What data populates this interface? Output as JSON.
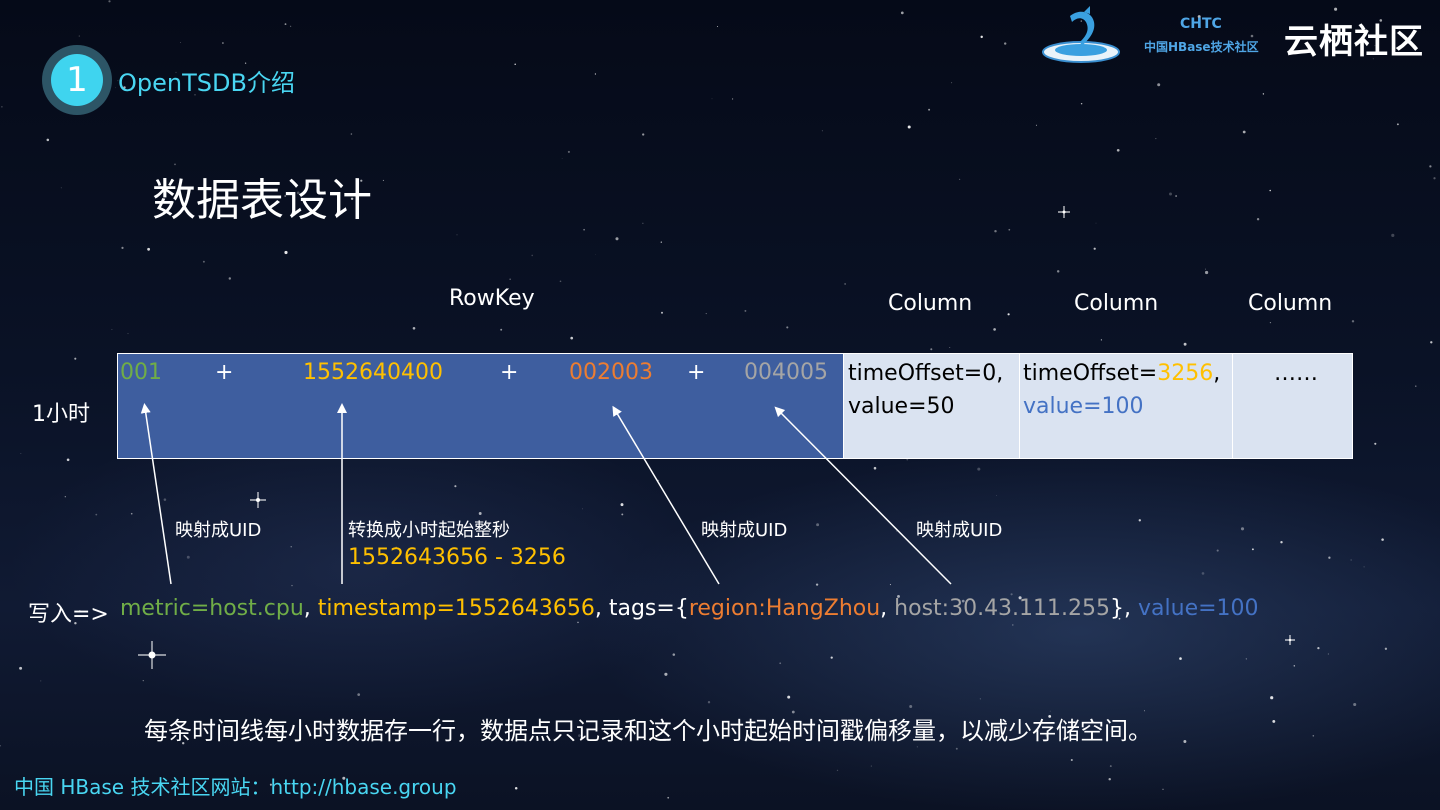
{
  "header": {
    "section_number": "1",
    "section_title": "OpenTSDB介绍",
    "logo_chtc": "CHTC",
    "logo_sub": "中国HBase技术社区",
    "logo_brand": "云栖社区"
  },
  "title": "数据表设计",
  "table": {
    "rowkey_label": "RowKey",
    "column_labels": [
      "Column",
      "Column",
      "Column"
    ],
    "row_label": "1小时",
    "rowkey_parts": {
      "metric_uid": "001",
      "plus": "+",
      "base_time": "1552640400",
      "tagk_uid": "002003",
      "tagv_uid": "004005"
    },
    "cell1": {
      "line1": "timeOffset=0,",
      "line2": "value=50"
    },
    "cell2": {
      "prefix": "timeOffset=",
      "offset": "3256",
      "comma": ",",
      "value": "value=100"
    },
    "cell3": "……"
  },
  "annotations": {
    "map_uid": "映射成UID",
    "convert": "转换成小时起始整秒",
    "calc": "1552643656 - 3256"
  },
  "write": {
    "prefix": "写入=>",
    "metric": "metric=host.cpu",
    "sep": ", ",
    "timestamp": "timestamp=1552643656",
    "tags_open": "tags={",
    "region": "region:HangZhou",
    "host": "host:30.43.111.255",
    "tags_close": "},",
    "value": "value=100"
  },
  "note": "每条时间线每小时数据存一行，数据点只记录和这个小时起始时间戳偏移量，以减少存储空间。",
  "footer": "中国 HBase 技术社区网站：http://hbase.group",
  "colors": {
    "green": "#70ad47",
    "yellow": "#ffc000",
    "orange": "#ed7d31",
    "gray": "#a5a5a5",
    "blue": "#4472c4",
    "cyan": "#49d6f2"
  }
}
